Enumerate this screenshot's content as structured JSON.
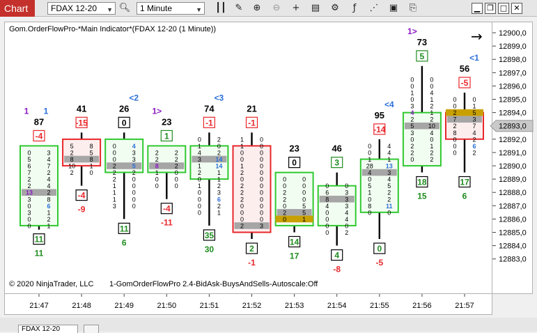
{
  "toolbar": {
    "tab_label": "Chart",
    "instrument": "FDAX 12-20",
    "interval": "1 Minute"
  },
  "window": {
    "minimize": "▁",
    "restore": "❐",
    "maximize": "□",
    "close": "✕"
  },
  "indicator_label": "Gom.OrderFlowPro-*Main Indicator*(FDAX 12-20 (1 Minute))",
  "copyright": "© 2020 NinjaTrader, LLC",
  "footer_label": "1-GomOrderFlowPro 2.4-BidAsk-BuysAndSells-Autoscale:Off",
  "bottom_tab": "FDAX 12-20",
  "colors": {
    "up_border": "#2fc92f",
    "down_border": "#e8262a",
    "up_fill": "#f2fdf2",
    "down_fill": "#fdeeee",
    "poc": "#a6a6a6",
    "gold": "#c8a000",
    "green_text": "#1f8c1f",
    "red_text": "#e8262a",
    "blue_text": "#2a6fd8",
    "purple_text": "#8b18c4"
  },
  "chart_data": {
    "type": "footprint",
    "title": "Gom.OrderFlowPro-*Main Indicator*(FDAX 12-20 (1 Minute))",
    "y_ticks": [
      "12900,0",
      "12899,0",
      "12898,0",
      "12897,0",
      "12896,0",
      "12895,0",
      "12894,0",
      "12893,0",
      "12892,0",
      "12891,0",
      "12890,0",
      "12889,0",
      "12888,0",
      "12887,0",
      "12886,0",
      "12885,0",
      "12884,0",
      "12883,0"
    ],
    "y_tick_values": [
      12900,
      12899,
      12898,
      12897,
      12896,
      12895,
      12894,
      12893,
      12892,
      12891,
      12890,
      12889,
      12888,
      12887,
      12886,
      12885,
      12884,
      12883
    ],
    "current_price": "12893,0",
    "current_price_value": 12893,
    "ylim": [
      12882.7,
      12900.3
    ],
    "candles": [
      {
        "time": "21:47",
        "type": "up",
        "open": 12886,
        "close": 12891,
        "high": 12891,
        "low": 12885.7,
        "poc_price": 12888,
        "top_label": "87",
        "top_delta": "-4",
        "top_delta_sign": "neg",
        "markers": [
          {
            "text": "1",
            "color": "purple"
          },
          {
            "text": "1",
            "color": "blue"
          }
        ],
        "bottom_box": "11",
        "bottom_value": "11",
        "bottom_value_sign": "pos",
        "rows": [
          {
            "p": 12891,
            "b": "0",
            "a": "3"
          },
          {
            "p": 12890.5,
            "b": "5",
            "a": "4"
          },
          {
            "p": 12890,
            "b": "6",
            "a": "7"
          },
          {
            "p": 12889.5,
            "b": "7",
            "a": "2"
          },
          {
            "p": 12889,
            "b": "2",
            "a": "4"
          },
          {
            "p": 12888.5,
            "b": "2",
            "a": "4"
          },
          {
            "p": 12888,
            "b": "13",
            "a": "2",
            "bc": "purple"
          },
          {
            "p": 12887.5,
            "b": "3",
            "a": "8"
          },
          {
            "p": 12887,
            "b": "0",
            "a": "6",
            "ac": "blue"
          },
          {
            "p": 12886.5,
            "b": "3",
            "a": "1"
          },
          {
            "p": 12886,
            "b": "0",
            "a": "2"
          },
          {
            "p": 12885.5,
            "b": "0",
            "a": "1"
          }
        ]
      },
      {
        "time": "21:48",
        "type": "down",
        "open": 12891.5,
        "close": 12890.5,
        "high": 12892,
        "low": 12889,
        "poc_price": 12890.5,
        "top_label": "41",
        "top_delta": "-15",
        "top_delta_sign": "neg",
        "markers": [],
        "bottom_box": "-4",
        "bottom_box_sign": "neg",
        "bottom_value": "-9",
        "bottom_value_sign": "neg",
        "rows": [
          {
            "p": 12891.5,
            "b": "5",
            "a": "8"
          },
          {
            "p": 12891,
            "b": "2",
            "a": "5"
          },
          {
            "p": 12890.5,
            "b": "8",
            "a": "8"
          },
          {
            "p": 12890,
            "b": "10",
            "a": "1"
          },
          {
            "p": 12889.5,
            "b": "2",
            "a": "0"
          }
        ]
      },
      {
        "time": "21:49",
        "type": "up",
        "open": 12890,
        "close": 12891.5,
        "high": 12892,
        "low": 12886.5,
        "poc_price": 12890,
        "top_label": "26",
        "top_delta": "0",
        "top_delta_sign": "zero",
        "markers": [
          {
            "text": "<2",
            "color": "blue"
          }
        ],
        "bottom_box": "11",
        "bottom_value": "6",
        "bottom_value_sign": "pos",
        "rows": [
          {
            "p": 12891.5,
            "b": "0",
            "a": "4",
            "ac": "blue"
          },
          {
            "p": 12891,
            "b": "0",
            "a": "3"
          },
          {
            "p": 12890.5,
            "b": "0",
            "a": "3"
          },
          {
            "p": 12890,
            "b": "2",
            "a": "5",
            "ac": "blue"
          },
          {
            "p": 12889.5,
            "b": "2",
            "a": "2"
          },
          {
            "p": 12889,
            "b": "2",
            "a": "0"
          },
          {
            "p": 12888.5,
            "b": "1",
            "a": "0"
          },
          {
            "p": 12888,
            "b": "1",
            "a": "0"
          },
          {
            "p": 12887.5,
            "b": "1",
            "a": "0"
          },
          {
            "p": 12887,
            "b": "3",
            "a": "0"
          }
        ]
      },
      {
        "time": "21:50",
        "type": "up",
        "open": 12890,
        "close": 12891,
        "high": 12891,
        "low": 12888,
        "poc_price": 12890,
        "top_label": "23",
        "top_delta": "1",
        "top_delta_sign": "pos",
        "markers": [
          {
            "text": "1>",
            "color": "purple"
          }
        ],
        "bottom_box": "-4",
        "bottom_box_sign": "neg",
        "bottom_value": "-11",
        "bottom_value_sign": "neg",
        "rows": [
          {
            "p": 12891,
            "b": "2",
            "a": "2"
          },
          {
            "p": 12890.5,
            "b": "2",
            "a": "2"
          },
          {
            "p": 12890,
            "b": "8",
            "a": "2",
            "bc": "purple"
          },
          {
            "p": 12889.5,
            "b": "1",
            "a": "0"
          },
          {
            "p": 12889,
            "b": "0",
            "a": "0"
          },
          {
            "p": 12888.5,
            "b": "0",
            "a": "0"
          }
        ]
      },
      {
        "time": "21:51",
        "type": "up",
        "open": 12889.5,
        "close": 12891,
        "high": 12892,
        "low": 12886,
        "poc_price": 12890.5,
        "top_label": "74",
        "top_delta": "-1",
        "top_delta_sign": "neg",
        "markers": [
          {
            "text": "<3",
            "color": "blue"
          }
        ],
        "bottom_box": "35",
        "bottom_value": "30",
        "bottom_value_sign": "pos",
        "rows": [
          {
            "p": 12892,
            "b": "0",
            "a": "2"
          },
          {
            "p": 12891.5,
            "b": "1",
            "a": "0"
          },
          {
            "p": 12891,
            "b": "4",
            "a": "2"
          },
          {
            "p": 12890.5,
            "b": "3",
            "a": "14",
            "ac": "blue"
          },
          {
            "p": 12890,
            "b": "1",
            "a": "14",
            "ac": "blue"
          },
          {
            "p": 12889.5,
            "b": "2",
            "a": "1"
          },
          {
            "p": 12889,
            "b": "0",
            "a": "1"
          },
          {
            "p": 12888.5,
            "b": "1",
            "a": "2"
          },
          {
            "p": 12888,
            "b": "0",
            "a": "3"
          },
          {
            "p": 12887.5,
            "b": "0",
            "a": "6",
            "ac": "blue"
          },
          {
            "p": 12887,
            "b": "0",
            "a": "2"
          },
          {
            "p": 12886.5,
            "b": "0",
            "a": "1"
          }
        ]
      },
      {
        "time": "21:52",
        "type": "down",
        "open": 12891,
        "close": 12885.5,
        "high": 12892,
        "low": 12885,
        "poc_price": 12885.5,
        "top_label": "21",
        "top_delta": "-1",
        "top_delta_sign": "neg",
        "markers": [],
        "bottom_box": "2",
        "bottom_value": "-1",
        "bottom_value_sign": "neg",
        "rows": [
          {
            "p": 12892,
            "b": "1",
            "a": "0"
          },
          {
            "p": 12891.5,
            "b": "1",
            "a": "0"
          },
          {
            "p": 12891,
            "b": "0",
            "a": "0"
          },
          {
            "p": 12890.5,
            "b": "0",
            "a": "0"
          },
          {
            "p": 12890,
            "b": "1",
            "a": "0"
          },
          {
            "p": 12889.5,
            "b": "2",
            "a": "0"
          },
          {
            "p": 12889,
            "b": "0",
            "a": "0"
          },
          {
            "p": 12888.5,
            "b": "2",
            "a": "0"
          },
          {
            "p": 12888,
            "b": "2",
            "a": "0"
          },
          {
            "p": 12887.5,
            "b": "2",
            "a": "0"
          },
          {
            "p": 12887,
            "b": "0",
            "a": "0"
          },
          {
            "p": 12886.5,
            "b": "0",
            "a": "0"
          },
          {
            "p": 12886,
            "b": "0",
            "a": "0"
          },
          {
            "p": 12885.5,
            "b": "2",
            "a": "3"
          }
        ]
      },
      {
        "time": "21:53",
        "type": "up",
        "open": 12886,
        "close": 12889,
        "high": 12889,
        "low": 12885.5,
        "poc_price": 12886.5,
        "top_label": "23",
        "top_delta": "0",
        "top_delta_sign": "zero",
        "markers": [],
        "bottom_box": "14",
        "bottom_value": "17",
        "bottom_value_sign": "pos",
        "rows": [
          {
            "p": 12889,
            "b": "0",
            "a": "0"
          },
          {
            "p": 12888.5,
            "b": "0",
            "a": "0"
          },
          {
            "p": 12888,
            "b": "2",
            "a": "0"
          },
          {
            "p": 12887.5,
            "b": "2",
            "a": "0"
          },
          {
            "p": 12887,
            "b": "0",
            "a": "5"
          },
          {
            "p": 12886.5,
            "b": "2",
            "a": "5"
          },
          {
            "p": 12886,
            "b": "0",
            "a": "1",
            "gold": true
          }
        ]
      },
      {
        "time": "21:54",
        "type": "up",
        "open": 12886,
        "close": 12888,
        "high": 12889,
        "low": 12884.5,
        "poc_price": 12887.5,
        "top_label": "46",
        "top_delta": "3",
        "top_delta_sign": "pos",
        "markers": [],
        "bottom_box": "4",
        "bottom_value": "-8",
        "bottom_value_sign": "neg",
        "rows": [
          {
            "p": 12888.5,
            "b": "0",
            "a": "0"
          },
          {
            "p": 12888,
            "b": "6",
            "a": "3"
          },
          {
            "p": 12887.5,
            "b": "8",
            "a": "3"
          },
          {
            "p": 12887,
            "b": "4",
            "a": "3"
          },
          {
            "p": 12886.5,
            "b": "0",
            "a": "4"
          },
          {
            "p": 12886,
            "b": "0",
            "a": "4"
          },
          {
            "p": 12885.5,
            "b": "0",
            "a": "0"
          },
          {
            "p": 12885,
            "b": "0",
            "a": "2"
          }
        ]
      },
      {
        "time": "21:55",
        "type": "up",
        "open": 12887,
        "close": 12890,
        "high": 12891.5,
        "low": 12885,
        "poc_price": 12889.5,
        "top_label": "95",
        "top_delta": "-14",
        "top_delta_sign": "neg",
        "markers": [
          {
            "text": "<4",
            "color": "blue"
          }
        ],
        "bottom_box": "0",
        "bottom_value": "-5",
        "bottom_value_sign": "neg",
        "rows": [
          {
            "p": 12891.5,
            "b": "0",
            "a": "4"
          },
          {
            "p": 12891,
            "b": "0",
            "a": "4"
          },
          {
            "p": 12890.5,
            "b": "1",
            "a": "1"
          },
          {
            "p": 12890,
            "b": "28",
            "a": "13",
            "ac": "blue"
          },
          {
            "p": 12889.5,
            "b": "4",
            "a": "3"
          },
          {
            "p": 12889,
            "b": "0",
            "a": "4"
          },
          {
            "p": 12888.5,
            "b": "5",
            "a": "5"
          },
          {
            "p": 12888,
            "b": "1",
            "a": "2"
          },
          {
            "p": 12887.5,
            "b": "0",
            "a": "2"
          },
          {
            "p": 12887,
            "b": "8",
            "a": "11",
            "ac": "blue"
          },
          {
            "p": 12886.5,
            "b": "0",
            "a": "0"
          }
        ]
      },
      {
        "time": "21:56",
        "type": "up",
        "open": 12890.5,
        "close": 12893.5,
        "high": 12897,
        "low": 12890,
        "poc_price": 12893,
        "top_label": "73",
        "top_delta": "5",
        "top_delta_sign": "pos",
        "markers": [
          {
            "text": "1>",
            "color": "purple"
          }
        ],
        "bottom_box": "18",
        "bottom_value": "15",
        "bottom_value_sign": "pos",
        "rows": [
          {
            "p": 12896.5,
            "b": "0",
            "a": "0"
          },
          {
            "p": 12896,
            "b": "0",
            "a": "0"
          },
          {
            "p": 12895.5,
            "b": "1",
            "a": "4"
          },
          {
            "p": 12895,
            "b": "0",
            "a": "1"
          },
          {
            "p": 12894.5,
            "b": "3",
            "a": "2"
          },
          {
            "p": 12894,
            "b": "4",
            "a": "1",
            "bc": "purple"
          },
          {
            "p": 12893.5,
            "b": "2",
            "a": "2"
          },
          {
            "p": 12893,
            "b": "5",
            "a": "10"
          },
          {
            "p": 12892.5,
            "b": "3",
            "a": "4"
          },
          {
            "p": 12892,
            "b": "0",
            "a": "0"
          },
          {
            "p": 12891.5,
            "b": "2",
            "a": "1"
          },
          {
            "p": 12891,
            "b": "2",
            "a": "2"
          },
          {
            "p": 12890.5,
            "b": "0",
            "a": "2"
          }
        ]
      },
      {
        "time": "21:57",
        "type": "down",
        "open": 12893.5,
        "close": 12892.5,
        "high": 12895,
        "low": 12890,
        "poc_price": 12893.5,
        "top_label": "56",
        "top_delta": "-5",
        "top_delta_sign": "neg",
        "markers": [
          {
            "text": "<1",
            "color": "blue"
          }
        ],
        "bottom_box": "17",
        "bottom_value": "6",
        "bottom_value_sign": "pos",
        "rows": [
          {
            "p": 12895,
            "b": "0",
            "a": "0"
          },
          {
            "p": 12894.5,
            "b": "0",
            "a": "1"
          },
          {
            "p": 12894,
            "b": "2",
            "a": "5",
            "gold": true
          },
          {
            "p": 12893.5,
            "b": "7",
            "a": "3"
          },
          {
            "p": 12893,
            "b": "2",
            "a": "7"
          },
          {
            "p": 12892.5,
            "b": "8",
            "a": "4"
          },
          {
            "p": 12892,
            "b": "0",
            "a": "2"
          },
          {
            "p": 12891.5,
            "b": "0",
            "a": "6",
            "ac": "blue"
          },
          {
            "p": 12891,
            "b": "0",
            "a": "2"
          }
        ]
      }
    ]
  }
}
